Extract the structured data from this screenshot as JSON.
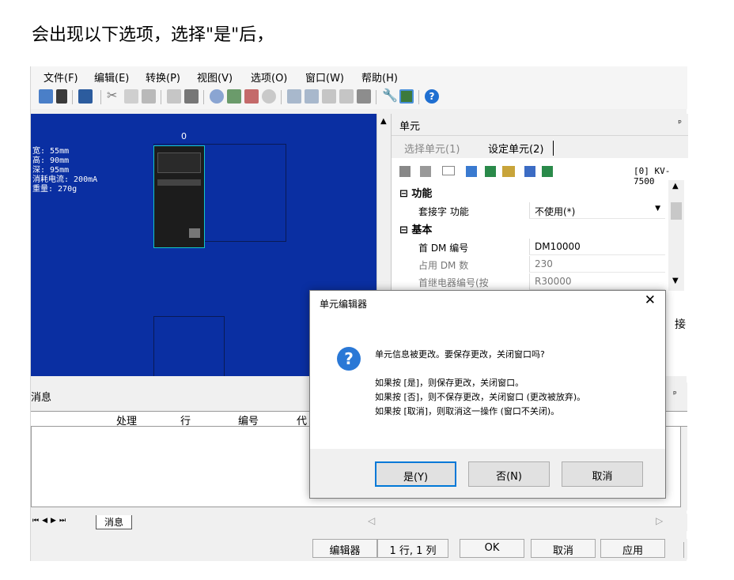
{
  "caption": "会出现以下选项，选择\"是\"后，",
  "menu": [
    "文件(F)",
    "编辑(E)",
    "转换(P)",
    "视图(V)",
    "选项(O)",
    "窗口(W)",
    "帮助(H)"
  ],
  "canvas": {
    "slot_label": "0",
    "specs": [
      "宽:  55mm",
      "高:  90mm",
      "深:  95mm",
      "消耗电流:  200mA",
      "重量:  270g"
    ]
  },
  "unit_panel": {
    "title": "单元",
    "pin": "ᵖ",
    "tab_select": "选择单元(1)",
    "tab_setup": "设定单元(2)",
    "model": "[0] KV-7500",
    "cat_function": "功能",
    "cat_basic": "基本",
    "rows": [
      {
        "key": "套接字 功能",
        "value": "不使用(*)"
      },
      {
        "key": "首 DM 编号",
        "value": "DM10000"
      },
      {
        "key": "占用 DM 数",
        "value": "230"
      },
      {
        "key": "首继电器编号(按",
        "value": "R30000"
      }
    ],
    "side_text": "接"
  },
  "message_panel": {
    "title": "消息",
    "pin": "ᵖ",
    "columns": [
      "处理",
      "行",
      "编号",
      "代"
    ],
    "tab_label": "消息"
  },
  "statusbar": {
    "mode": "编辑器",
    "position": "1 行, 1 列",
    "ok": "OK",
    "cancel": "取消",
    "apply": "应用"
  },
  "dialog": {
    "title": "单元编辑器",
    "close": "✕",
    "icon": "?",
    "question": "单元信息被更改。要保存更改，关闭窗口吗?",
    "line1": "如果按 [是]，则保存更改，关闭窗口。",
    "line2": "如果按 [否]，则不保存更改，关闭窗口 (更改被放弃)。",
    "line3": "如果按 [取消]，则取消这一操作 (窗口不关闭)。",
    "yes": "是(Y)",
    "no": "否(N)",
    "cancel": "取消"
  },
  "colors": {
    "canvas_bg": "#0a2fa2",
    "module_border": "#12c7c7",
    "accent_blue": "#0078d7"
  },
  "icons": [
    "undo-icon",
    "scissors-icon",
    "copy-icon",
    "paste-icon",
    "wrench-icon",
    "help-icon"
  ]
}
